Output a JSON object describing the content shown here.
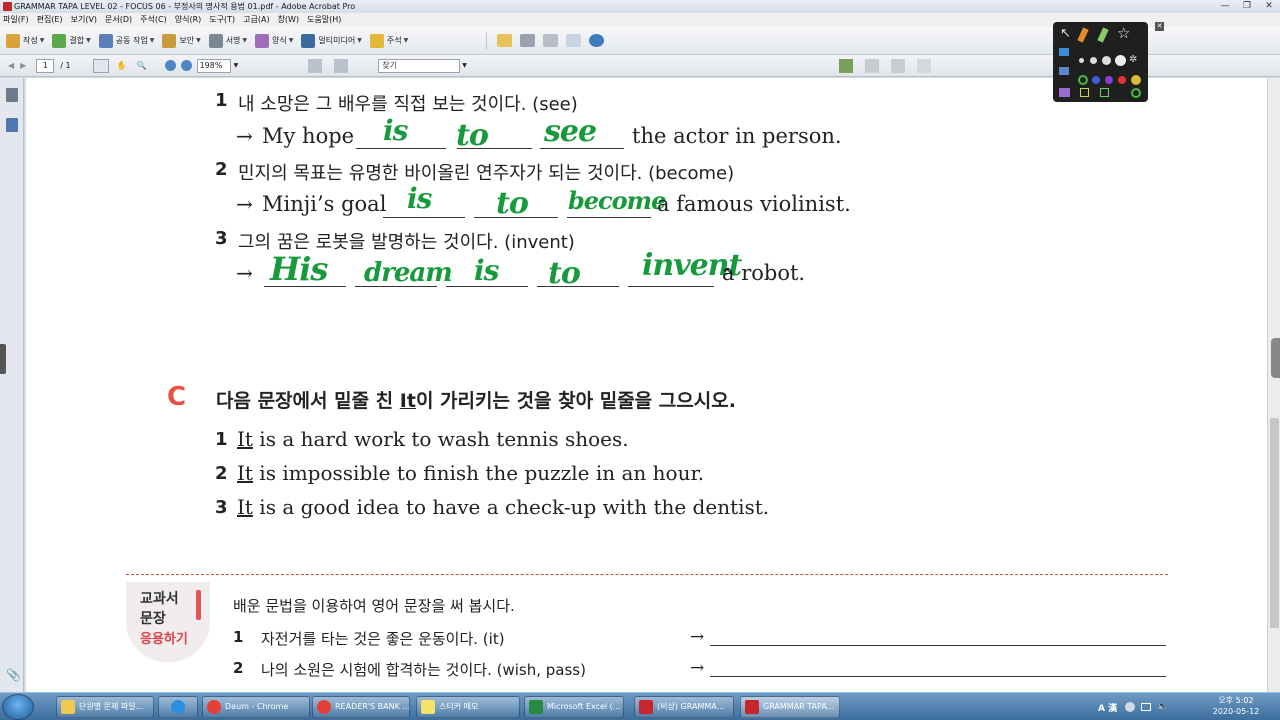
{
  "window": {
    "title": "GRAMMAR TAPA LEVEL 02 - FOCUS 06 - 부정사의 명사적 용법 01.pdf - Adobe Acrobat Pro",
    "controls": [
      "—",
      "❐",
      "✕"
    ]
  },
  "menu": [
    "파일(F)",
    "편집(E)",
    "보기(V)",
    "문서(D)",
    "주석(C)",
    "양식(R)",
    "도구(T)",
    "고급(A)",
    "창(W)",
    "도움말(H)"
  ],
  "toolbar": {
    "create": "작성",
    "combine": "결합",
    "collaborate": "공동 작업",
    "secure": "보안",
    "sign": "서명",
    "forms": "양식",
    "multimedia": "멀티미디어",
    "comment": "주석"
  },
  "nav": {
    "page_current": "1",
    "page_total": "/ 1",
    "zoom": "198%",
    "find_placeholder": "찾기"
  },
  "doc": {
    "b_items": [
      {
        "num": "1",
        "prompt": "내 소망은 그 배우를 직접 보는 것이다. (see)",
        "arrow": "→",
        "lead": "My hope",
        "tail": "the actor in person.",
        "answers": [
          "is",
          "to",
          "see"
        ]
      },
      {
        "num": "2",
        "prompt": "민지의 목표는 유명한 바이올린 연주자가 되는 것이다. (become)",
        "arrow": "→",
        "lead": "Minji’s goal",
        "tail": "a famous violinist.",
        "answers": [
          "is",
          "to",
          "become"
        ]
      },
      {
        "num": "3",
        "prompt": "그의 꿈은 로봇을 발명하는 것이다. (invent)",
        "arrow": "→",
        "lead": "",
        "tail": "a robot.",
        "answers": [
          "His",
          "dream",
          "is",
          "to",
          "invent"
        ]
      }
    ],
    "section_c": {
      "letter": "C",
      "instruction_pre": "다음 문장에서 밑줄 친 ",
      "instruction_it": "It",
      "instruction_post": "이 가리키는 것을 찾아 밑줄을 그으시오.",
      "items": [
        {
          "num": "1",
          "it": "It",
          "rest": " is a hard work to wash tennis shoes."
        },
        {
          "num": "2",
          "it": "It",
          "rest": " is impossible to finish the puzzle in an hour."
        },
        {
          "num": "3",
          "it": "It",
          "rest": " is a good idea to have a check-up with the dentist."
        }
      ]
    },
    "textbook": {
      "badge_line1": "교과서",
      "badge_line2": "문장",
      "badge_line3": "응용하기",
      "instruction": "배운 문법을 이용하여 영어 문장을 써 봅시다.",
      "items": [
        {
          "num": "1",
          "text": "자전거를 타는 것은 좋은 운동이다. (it)",
          "arrow": "→"
        },
        {
          "num": "2",
          "text": "나의 소원은 시험에 합격하는 것이다. (wish, pass)",
          "arrow": "→"
        }
      ]
    }
  },
  "taskbar": {
    "tasks": [
      "단원별 문제 파일...",
      "",
      "Daum - Chrome",
      "READER'S BANK ...",
      "스티커 메모",
      "Microsoft Excel (...",
      "(비상) GRAMMA...",
      "GRAMMAR TAPA..."
    ],
    "tray": "A 漢",
    "time": "오후 5:02",
    "date": "2020-05-12"
  },
  "colors": {
    "ink_green": "#179a3b",
    "accent_red": "#e7513f",
    "taskbar_blue": "#3c6d9c"
  }
}
